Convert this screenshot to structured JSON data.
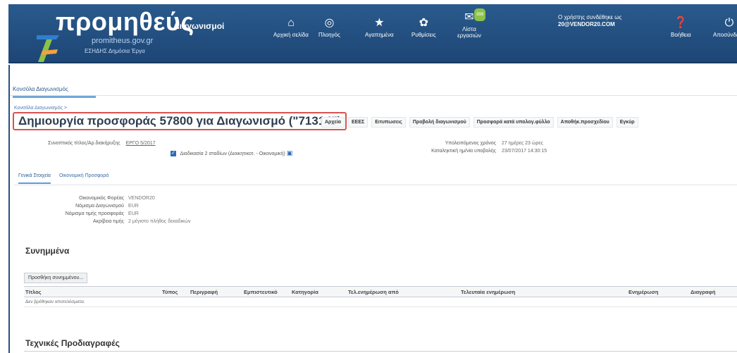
{
  "header": {
    "logo_main": "προμηθεύς",
    "logo_sub": "Διαγωνισμοί",
    "logo_url": "promitheus.gov.gr",
    "logo_tag": "ΕΣΗΔΗΣ  Δημόσια Έργα",
    "nav": [
      {
        "label": "Αρχική σελίδα",
        "icon": "home-icon"
      },
      {
        "label": "Πλοηγός",
        "icon": "compass-icon"
      },
      {
        "label": "Αγαπημένα",
        "icon": "star-icon"
      },
      {
        "label": "Ρυθμίσεις",
        "icon": "gear-icon"
      },
      {
        "label": "Λίστα εργασιών",
        "icon": "bell-icon"
      },
      {
        "label": "Βοήθεια",
        "icon": "help-icon"
      },
      {
        "label": "Αποσύνδεση",
        "icon": "power-icon"
      }
    ],
    "notification_count": "999",
    "user_line1": "Ο χρήστης συνδέθηκε ως",
    "user_line2": "20@VENDOR20.COM"
  },
  "top_tab": "Κονσόλα Διαγωνισμός",
  "breadcrumb": "Κονσόλα Διαγωνισμός >",
  "page_title": "Δημιουργία προσφοράς 57800 για Διαγωνισμό (\"71314\")",
  "actions": [
    "Αρχεία",
    "ΕΕΕΣ",
    "Ειτυπωσεις",
    "Προβολή διαγωνισμού",
    "Προσφορά κατά υπολογ.φύλλο",
    "Αποθήκ.προσχεδίου",
    "Εγκύρ"
  ],
  "fields": {
    "ref_label": "Συνοπτικός τίτλος/Αρ.διακήρυξης",
    "ref_value": "ΕΡΓΟ 5/2017",
    "checkbox_label": "Διαδικασία 2 σταδίων (Διοικητικοτ. - Οικονομική)",
    "time_left_label": "Υπολειπόμενος χρόνος",
    "time_left_value": "27 ημέρες 23 ώρες",
    "deadline_label": "Καταληκτική ημ/νία υποβολής",
    "deadline_value": "23/07/2017 14:30:15"
  },
  "subtabs": [
    "Γενικά Στοιχεία",
    "Οικονομική Προσφορά"
  ],
  "info": [
    {
      "label": "Οικονομικός Φορέας",
      "value": "VENDOR20"
    },
    {
      "label": "Νόμισμα Διαγωνισμού",
      "value": "EUR"
    },
    {
      "label": "Νόμισμα τιμής προσφοράς",
      "value": "EUR"
    },
    {
      "label": "Ακρίβεια τιμής",
      "value": "2 μέγιστο πλήθος δεκαδικών"
    }
  ],
  "attachments": {
    "title": "Συνημμένα",
    "add_button": "Προσθήκη συνημμένου...",
    "columns": [
      "Τίτλος",
      "Τύπος",
      "Περιγραφή",
      "Εμπιστευτικό",
      "Κατηγορία",
      "Τελ.ενημέρωση από",
      "Τελευταία ενημέρωση",
      "Ενημέρωση",
      "Διαγραφή"
    ],
    "empty_text": "Δεν βρέθηκαν αποτελέσματα."
  },
  "specs_title": "Τεχνικές Προδιαγραφές",
  "colors": {
    "header_bg": "#1f4b7d",
    "title_border": "#d9534f",
    "link": "#2a6ab5"
  }
}
